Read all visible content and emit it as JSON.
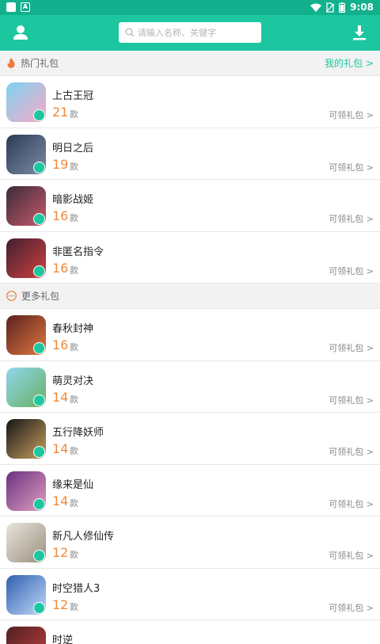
{
  "status_bar": {
    "time": "9:08"
  },
  "header": {
    "search_placeholder": "请输入名称、关键字"
  },
  "hot_section": {
    "title": "热门礼包",
    "link": "我的礼包 >"
  },
  "more_section": {
    "title": "更多礼包"
  },
  "unit": "款",
  "claim_label": "可领礼包 >",
  "hot_items": [
    {
      "name": "上古王冠",
      "count": "21",
      "colors": [
        "#7fd3f0",
        "#f6a9c7"
      ]
    },
    {
      "name": "明日之后",
      "count": "19",
      "colors": [
        "#2b3b55",
        "#7d8da8"
      ]
    },
    {
      "name": "暗影战姬",
      "count": "16",
      "colors": [
        "#3a2a3a",
        "#c85a6a"
      ]
    },
    {
      "name": "非匿名指令",
      "count": "16",
      "colors": [
        "#402030",
        "#d04040"
      ]
    }
  ],
  "more_items": [
    {
      "name": "春秋封神",
      "count": "16",
      "colors": [
        "#5a2020",
        "#e07a40"
      ]
    },
    {
      "name": "萌灵对决",
      "count": "14",
      "colors": [
        "#8fd6f0",
        "#6ab060"
      ]
    },
    {
      "name": "五行降妖师",
      "count": "14",
      "colors": [
        "#151515",
        "#c9a060"
      ]
    },
    {
      "name": "缘来是仙",
      "count": "14",
      "colors": [
        "#6a3080",
        "#e0a0c0"
      ]
    },
    {
      "name": "新凡人修仙传",
      "count": "12",
      "colors": [
        "#e8e4dc",
        "#9c9080"
      ]
    },
    {
      "name": "时空猎人3",
      "count": "12",
      "colors": [
        "#3060b0",
        "#c0d8f8"
      ]
    },
    {
      "name": "时逆",
      "count": "",
      "colors": [
        "#502020",
        "#c04040"
      ]
    }
  ]
}
